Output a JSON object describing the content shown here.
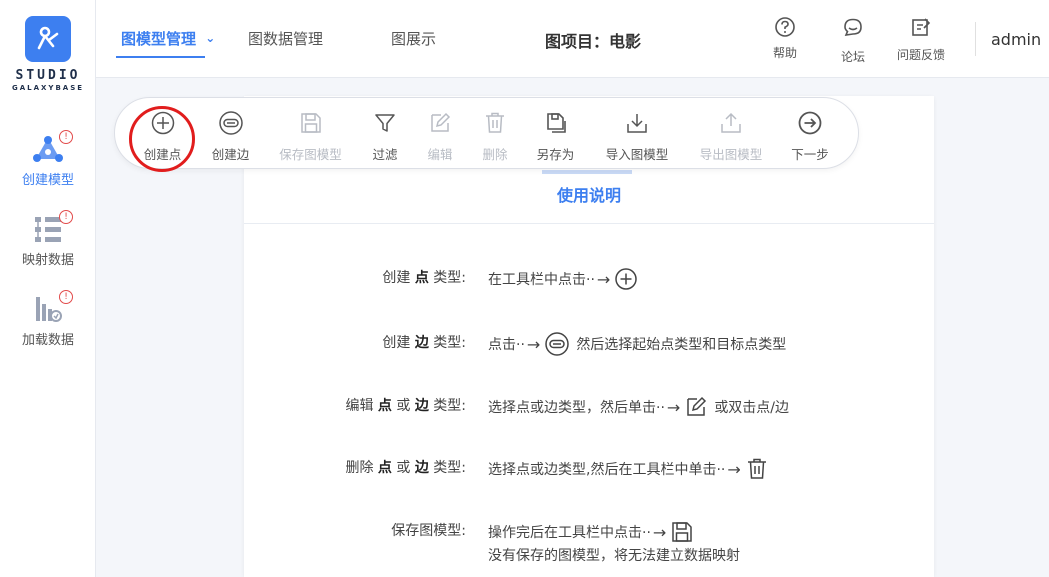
{
  "logo": {
    "title": "STUDIO",
    "subtitle": "GALAXYBASE"
  },
  "sidebar": {
    "items": [
      {
        "label": "创建模型",
        "icon": "create-model-icon",
        "badge": "!"
      },
      {
        "label": "映射数据",
        "icon": "map-data-icon",
        "badge": "!"
      },
      {
        "label": "加载数据",
        "icon": "load-data-icon",
        "badge": "!"
      }
    ]
  },
  "header": {
    "tabs": [
      {
        "label": "图模型管理",
        "arrow": "⌄"
      },
      {
        "label": "图数据管理"
      },
      {
        "label": "图展示"
      }
    ],
    "project": "图项目：电影",
    "links": [
      {
        "label": "帮助",
        "icon": "help-icon"
      },
      {
        "label": "论坛",
        "icon": "forum-icon"
      },
      {
        "label": "问题反馈",
        "icon": "feedback-icon"
      }
    ],
    "user": "admin"
  },
  "toolbar": {
    "buttons": [
      {
        "label": "创建点",
        "icon": "plus-circle-icon",
        "disabled": false
      },
      {
        "label": "创建边",
        "icon": "link-icon",
        "disabled": false
      },
      {
        "label": "保存图模型",
        "icon": "save-icon",
        "disabled": true
      },
      {
        "label": "过滤",
        "icon": "filter-icon",
        "disabled": false
      },
      {
        "label": "编辑",
        "icon": "edit-icon",
        "disabled": true
      },
      {
        "label": "删除",
        "icon": "trash-icon",
        "disabled": true
      },
      {
        "label": "另存为",
        "icon": "save-as-icon",
        "disabled": false
      },
      {
        "label": "导入图模型",
        "icon": "import-icon",
        "disabled": false
      },
      {
        "label": "导出图模型",
        "icon": "export-icon",
        "disabled": true
      },
      {
        "label": "下一步",
        "icon": "next-icon",
        "disabled": false
      }
    ]
  },
  "instructions": {
    "title": "使用说明",
    "rows": [
      {
        "pre": "创建",
        "b1": "点",
        "mid": "",
        "b2": "",
        "post": "类型:",
        "desc_pre": "在工具栏中点击··",
        "arrow": "→",
        "icon": "plus-circle-icon",
        "desc_post": ""
      },
      {
        "pre": "创建",
        "b1": "边",
        "mid": "",
        "b2": "",
        "post": "类型:",
        "desc_pre": "点击··",
        "arrow": "→",
        "icon": "link-icon",
        "desc_post": "然后选择起始点类型和目标点类型"
      },
      {
        "pre": "编辑",
        "b1": "点",
        "mid": "或",
        "b2": "边",
        "post": "类型:",
        "desc_pre": "选择点或边类型，然后单击··",
        "arrow": "→",
        "icon": "edit-icon",
        "desc_post": "或双击点/边"
      },
      {
        "pre": "删除",
        "b1": "点",
        "mid": "或",
        "b2": "边",
        "post": "类型:",
        "desc_pre": "选择点或边类型,然后在工具栏中单击··",
        "arrow": "→",
        "icon": "trash-icon",
        "desc_post": ""
      },
      {
        "pre": "保存图模型:",
        "b1": "",
        "mid": "",
        "b2": "",
        "post": "",
        "desc_pre": "操作完后在工具栏中点击··",
        "arrow": "→",
        "icon": "save-icon",
        "desc_post": "",
        "desc_line2": "没有保存的图模型，将无法建立数据映射"
      }
    ]
  },
  "colors": {
    "accent": "#3d7ff0",
    "highlight": "#e11d1d",
    "warning": "#e24a4a"
  }
}
